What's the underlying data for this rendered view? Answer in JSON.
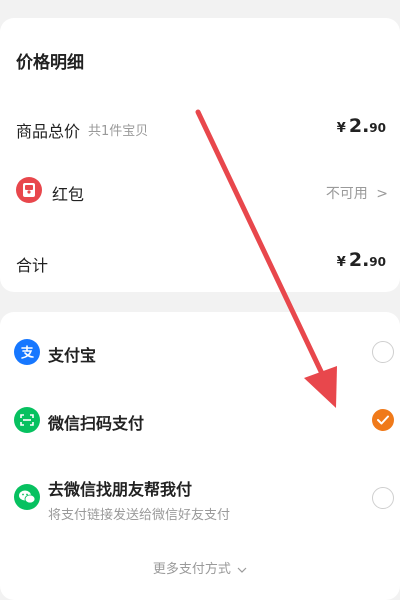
{
  "price_detail": {
    "title": "价格明细",
    "goods_total": {
      "label": "商品总价",
      "sub": "共1件宝贝",
      "currency": "¥",
      "amount_int": "2.",
      "amount_dec": "90"
    },
    "red_packet": {
      "label": "红包",
      "status": "不可用",
      "chevron": ">",
      "icon": "red-packet-icon"
    },
    "total": {
      "label": "合计",
      "currency": "¥",
      "amount_int": "2.",
      "amount_dec": "90"
    }
  },
  "payment": {
    "options": [
      {
        "label": "支付宝",
        "icon": "alipay-icon",
        "color": "#1677ff",
        "selected": false
      },
      {
        "label": "微信扫码支付",
        "icon": "wechat-scan-icon",
        "color": "#07c160",
        "selected": true
      },
      {
        "label": "去微信找朋友帮我付",
        "sub": "将支付链接发送给微信好友支付",
        "icon": "wechat-friend-icon",
        "color": "#07c160",
        "selected": false
      }
    ],
    "more": "更多支付方式"
  },
  "annotation": {
    "arrow_color": "#e8474c"
  },
  "colors": {
    "accent_orange": "#f07a1a",
    "alipay_blue": "#1677ff",
    "wechat_green": "#07c160",
    "red_packet": "#e8474c"
  }
}
